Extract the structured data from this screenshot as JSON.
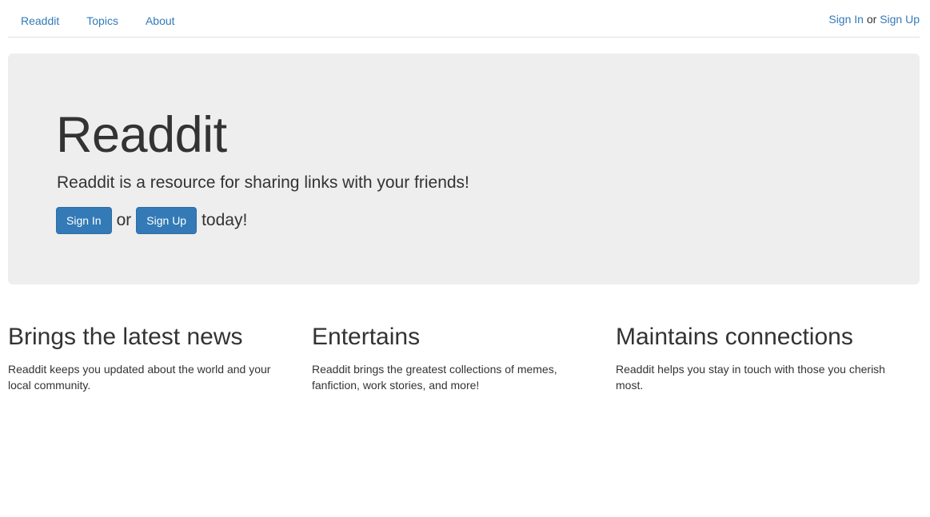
{
  "nav": {
    "links": [
      "Readdit",
      "Topics",
      "About"
    ],
    "sign_in": "Sign In",
    "or": "or",
    "sign_up": "Sign Up"
  },
  "hero": {
    "title": "Readdit",
    "lead": "Readdit is a resource for sharing links with your friends!",
    "sign_in_button": "Sign In",
    "or": "or",
    "sign_up_button": "Sign Up",
    "today": "today!"
  },
  "features": [
    {
      "heading": "Brings the latest news",
      "text": "Readdit keeps you updated about the world and your local community."
    },
    {
      "heading": "Entertains",
      "text": "Readdit brings the greatest collections of memes, fanfiction, work stories, and more!"
    },
    {
      "heading": "Maintains connections",
      "text": "Readdit helps you stay in touch with those you cherish most."
    }
  ],
  "colors": {
    "link": "#337ab7",
    "button": "#337ab7",
    "jumbotron_bg": "#eeeeee",
    "text": "#333333"
  }
}
